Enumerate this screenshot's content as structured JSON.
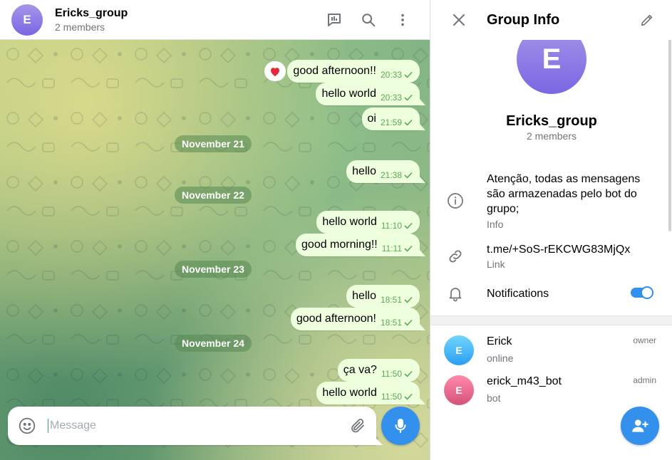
{
  "chat": {
    "title": "Ericks_group",
    "subtitle": "2 members",
    "avatar_letter": "E",
    "composer_placeholder": "Message",
    "messages": [
      {
        "text": "good afternoon!!",
        "time": "20:33",
        "reaction": "heart"
      },
      {
        "text": "hello world",
        "time": "20:33"
      },
      {
        "text": "oi",
        "time": "21:59"
      },
      {
        "text": "hello",
        "time": "21:38"
      },
      {
        "text": "hello world",
        "time": "11:10"
      },
      {
        "text": "good morning!!",
        "time": "11:11"
      },
      {
        "text": "hello",
        "time": "18:51"
      },
      {
        "text": "good afternoon!",
        "time": "18:51"
      },
      {
        "text": "ça va?",
        "time": "11:50"
      },
      {
        "text": "hello world",
        "time": "11:50"
      }
    ],
    "dates": [
      "November 21",
      "November 22",
      "November 23",
      "November 24"
    ]
  },
  "info": {
    "title": "Group Info",
    "avatar_letter": "E",
    "name": "Ericks_group",
    "members_count": "2 members",
    "description": "Atenção, todas as mensagens são armazenadas pelo bot do grupo;",
    "description_label": "Info",
    "link": "t.me/+SoS-rEKCWG83MjQx",
    "link_label": "Link",
    "notifications_label": "Notifications",
    "notifications_enabled": true,
    "members": [
      {
        "avatar_letter": "E",
        "name": "Erick",
        "status": "online",
        "role": "owner"
      },
      {
        "avatar_letter": "E",
        "name": "erick_m43_bot",
        "status": "bot",
        "role": "admin"
      }
    ]
  },
  "colors": {
    "accent": "#3390ec",
    "bubble_out": "#eeffde",
    "time_green": "#5ca853"
  }
}
